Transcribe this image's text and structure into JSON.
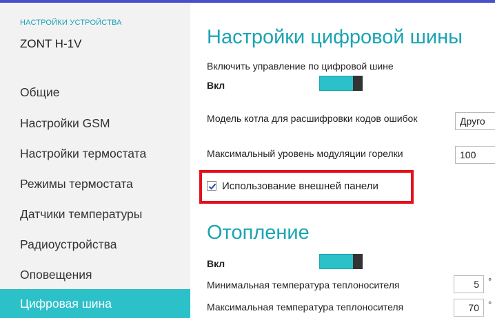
{
  "sidebar": {
    "caption": "НАСТРОЙКИ УСТРОЙСТВА",
    "device": "ZONT H-1V",
    "items": [
      {
        "label": "Общие"
      },
      {
        "label": "Настройки GSM"
      },
      {
        "label": "Настройки термостата"
      },
      {
        "label": "Режимы термостата"
      },
      {
        "label": "Датчики температуры"
      },
      {
        "label": "Радиоустройства"
      },
      {
        "label": "Оповещения"
      },
      {
        "label": "Цифровая шина"
      }
    ],
    "active_index": 7
  },
  "main": {
    "digital_bus": {
      "title": "Настройки цифровой шины",
      "enable_label": "Включить управление по цифровой шине",
      "enable_state": "Вкл",
      "enable_toggle_on": true,
      "boiler_model_label": "Модель котла для расшифровки кодов ошибок",
      "boiler_model_value": "Друго",
      "max_modulation_label": "Максимальный уровень модуляции горелки",
      "max_modulation_value": "100",
      "external_panel_label": "Использование внешней панели",
      "external_panel_checked": true
    },
    "heating": {
      "title": "Отопление",
      "state": "Вкл",
      "toggle_on": true,
      "min_temp_label": "Минимальная температура теплоносителя",
      "min_temp_value": "5",
      "max_temp_label": "Максимальная температура теплоносителя",
      "max_temp_value": "70",
      "unit": "°"
    }
  },
  "colors": {
    "accent": "#2cc0c9",
    "accent_text": "#1aa4b3",
    "highlight": "#e3111b",
    "top_bar": "#4a4fc9",
    "sidebar_bg": "#f2f2f2"
  }
}
